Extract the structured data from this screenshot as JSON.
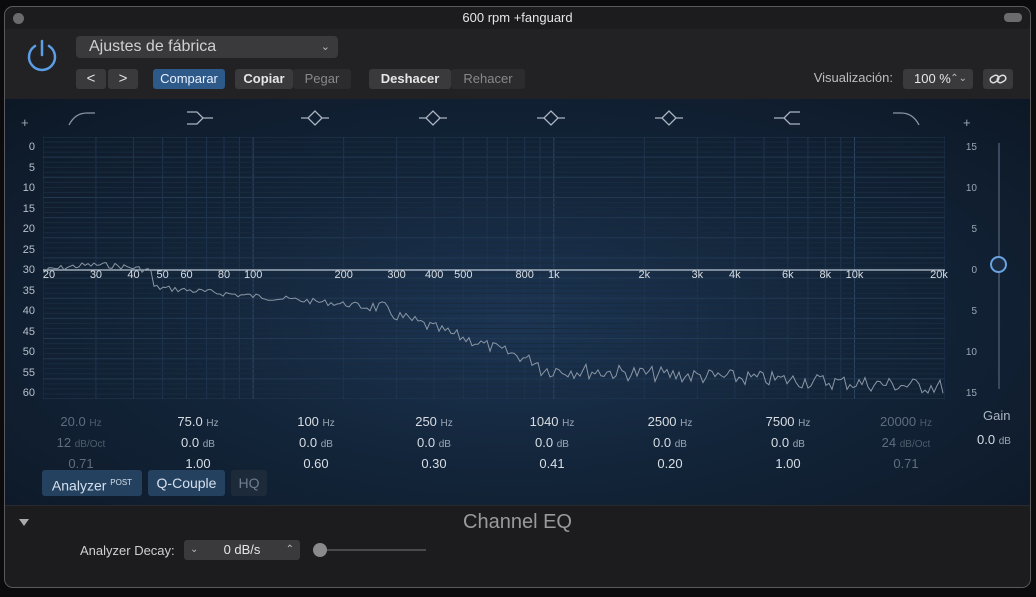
{
  "window": {
    "title": "600 rpm +fanguard"
  },
  "header": {
    "preset": "Ajustes de fábrica",
    "nav_prev": "<",
    "nav_next": ">",
    "compare": "Comparar",
    "copy": "Copiar",
    "paste": "Pegar",
    "undo": "Deshacer",
    "redo": "Rehacer",
    "view_label": "Visualización:",
    "view_value": "100 %"
  },
  "graph": {
    "db_left": [
      "0",
      "5",
      "10",
      "15",
      "20",
      "25",
      "30",
      "35",
      "40",
      "45",
      "50",
      "55",
      "60"
    ],
    "db_right": [
      "15",
      "10",
      "5",
      "0",
      "5",
      "10",
      "15"
    ],
    "freq_labels": [
      "20",
      "30",
      "40",
      "50",
      "60",
      "80",
      "100",
      "200",
      "300",
      "400",
      "500",
      "800",
      "1k",
      "2k",
      "3k",
      "4k",
      "6k",
      "8k",
      "10k",
      "20k"
    ],
    "plus": "+"
  },
  "bands": [
    {
      "freq": "20.0",
      "freq_unit": "Hz",
      "gain": "12",
      "gain_unit": "dB/Oct",
      "q": "0.71",
      "enabled": false
    },
    {
      "freq": "75.0",
      "freq_unit": "Hz",
      "gain": "0.0",
      "gain_unit": "dB",
      "q": "1.00",
      "enabled": true
    },
    {
      "freq": "100",
      "freq_unit": "Hz",
      "gain": "0.0",
      "gain_unit": "dB",
      "q": "0.60",
      "enabled": true
    },
    {
      "freq": "250",
      "freq_unit": "Hz",
      "gain": "0.0",
      "gain_unit": "dB",
      "q": "0.30",
      "enabled": true
    },
    {
      "freq": "1040",
      "freq_unit": "Hz",
      "gain": "0.0",
      "gain_unit": "dB",
      "q": "0.41",
      "enabled": true
    },
    {
      "freq": "2500",
      "freq_unit": "Hz",
      "gain": "0.0",
      "gain_unit": "dB",
      "q": "0.20",
      "enabled": true
    },
    {
      "freq": "7500",
      "freq_unit": "Hz",
      "gain": "0.0",
      "gain_unit": "dB",
      "q": "1.00",
      "enabled": true
    },
    {
      "freq": "20000",
      "freq_unit": "Hz",
      "gain": "24",
      "gain_unit": "dB/Oct",
      "q": "0.71",
      "enabled": false
    }
  ],
  "gain": {
    "label": "Gain",
    "value": "0.0",
    "unit": "dB"
  },
  "buttons": {
    "analyzer": "Analyzer",
    "analyzer_sup": "POST",
    "qcouple": "Q-Couple",
    "hq": "HQ"
  },
  "footer": {
    "plugin_name": "Channel EQ",
    "decay_label": "Analyzer Decay:",
    "decay_value": "0 dB/s"
  },
  "colors": {
    "accent": "#2e5a8a",
    "curve": "#a9b8c8",
    "knob": "#6aa3e0"
  }
}
